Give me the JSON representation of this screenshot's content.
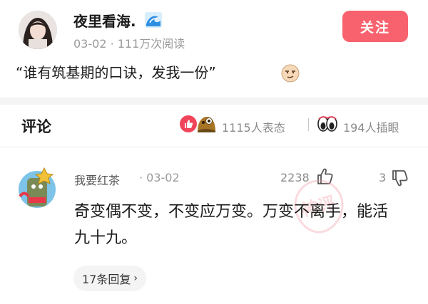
{
  "post": {
    "author": "夜里看海.",
    "author_badge_icon": "wave-icon",
    "meta": "03-02 · 111万次阅读",
    "follow_label": "关注",
    "text": "“谁有筑基期的口诀，发我一份”",
    "trailing_emoji_icon": "smirk-face-icon"
  },
  "comments_header": {
    "title": "评论",
    "reactions_text": "1115人表态",
    "eyes_text": "194人插眼"
  },
  "comment": {
    "user": "我要红茶",
    "date": "· 03-02",
    "likes": "2238",
    "dislikes": "3",
    "text": "奇变偶不变，不变应万变。万变不离手，能活九十九。",
    "watermark_text": "神评",
    "replies_label": "17条回复",
    "replies_chevron": "›"
  },
  "colors": {
    "accent": "#f8626e",
    "meta_gray": "#9a9a9a",
    "band": "#f4f4f4"
  }
}
